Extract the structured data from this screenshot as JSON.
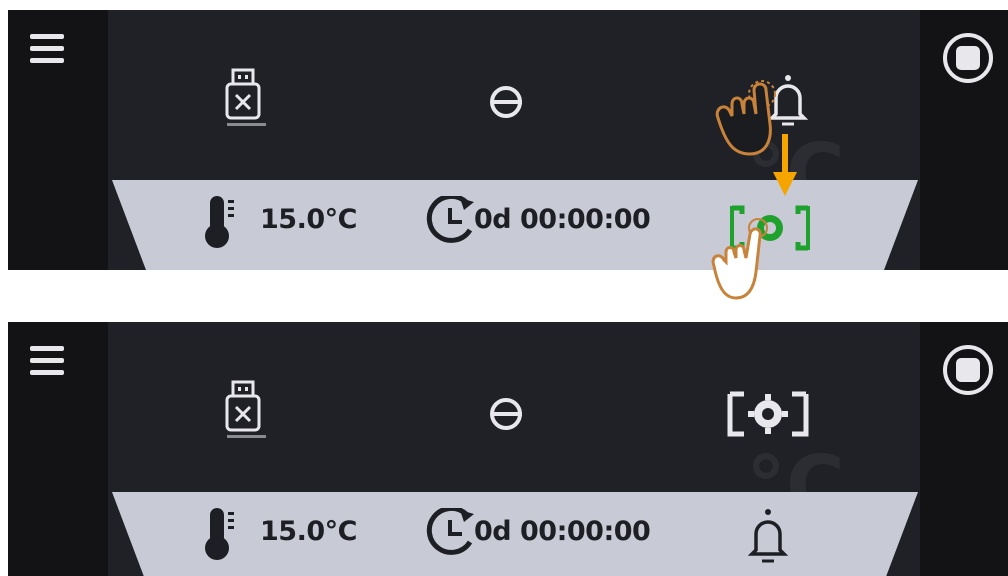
{
  "screens": [
    {
      "id": "before",
      "status": {
        "temperature": "15.0°C",
        "timer": "0d 00:00:00"
      },
      "ghost_text": [
        "°C"
      ],
      "toolbar": [
        "usb-eject",
        "logout",
        "alarm-bell"
      ],
      "status_right_icon": "settings-frame-highlighted"
    },
    {
      "id": "after",
      "status": {
        "temperature": "15.0°C",
        "timer": "0d 00:00:00"
      },
      "ghost_text": [
        "°C"
      ],
      "toolbar": [
        "usb-eject",
        "logout",
        "settings-frame"
      ],
      "status_right_icon": "alarm-bell"
    }
  ],
  "colors": {
    "screen_bg": "#1b1c20",
    "status_bar": "#c8cad6",
    "icon_light": "#e8e8ec",
    "highlight_green": "#1fa12e",
    "arrow_orange": "#f5a400",
    "hand_outline": "#c8823a"
  }
}
